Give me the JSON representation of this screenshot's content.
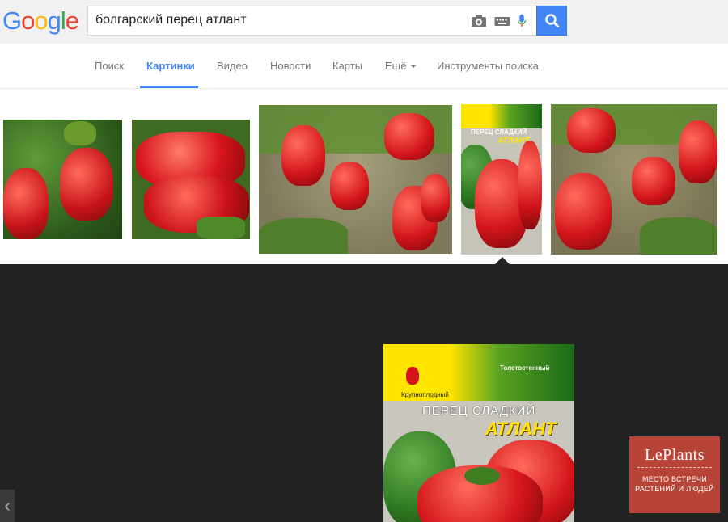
{
  "logo": {
    "letters": [
      "G",
      "o",
      "o",
      "g",
      "l",
      "e"
    ],
    "colors": [
      "#4285f4",
      "#ea4335",
      "#fbbc05",
      "#4285f4",
      "#34a853",
      "#ea4335"
    ]
  },
  "search": {
    "query": "болгарский перец атлант"
  },
  "tabs": [
    {
      "label": "Поиск",
      "active": false
    },
    {
      "label": "Картинки",
      "active": true
    },
    {
      "label": "Видео",
      "active": false
    },
    {
      "label": "Новости",
      "active": false
    },
    {
      "label": "Карты",
      "active": false
    },
    {
      "label": "Ещё",
      "active": false
    },
    {
      "label": "Инструменты поиска",
      "active": false
    }
  ],
  "preview": {
    "badge": "Толстостенный",
    "type": "Крупноплодный",
    "title": "ПЕРЕЦ СЛАДКИЙ",
    "variety": "АТЛАНТ"
  },
  "thumb4": {
    "title": "ПЕРЕЦ СЛАДКИЙ",
    "variety": "АТЛАНТ"
  },
  "watermark": {
    "brand": "LePlants",
    "tagline_1": "МЕСТО ВСТРЕЧИ",
    "tagline_2": "РАСТЕНИЙ И ЛЮДЕЙ"
  },
  "colors": {
    "accent": "#4285f4",
    "viewer_bg": "#222222",
    "pepper_red": "#d81e1e",
    "leaf_green": "#3f7d22"
  }
}
